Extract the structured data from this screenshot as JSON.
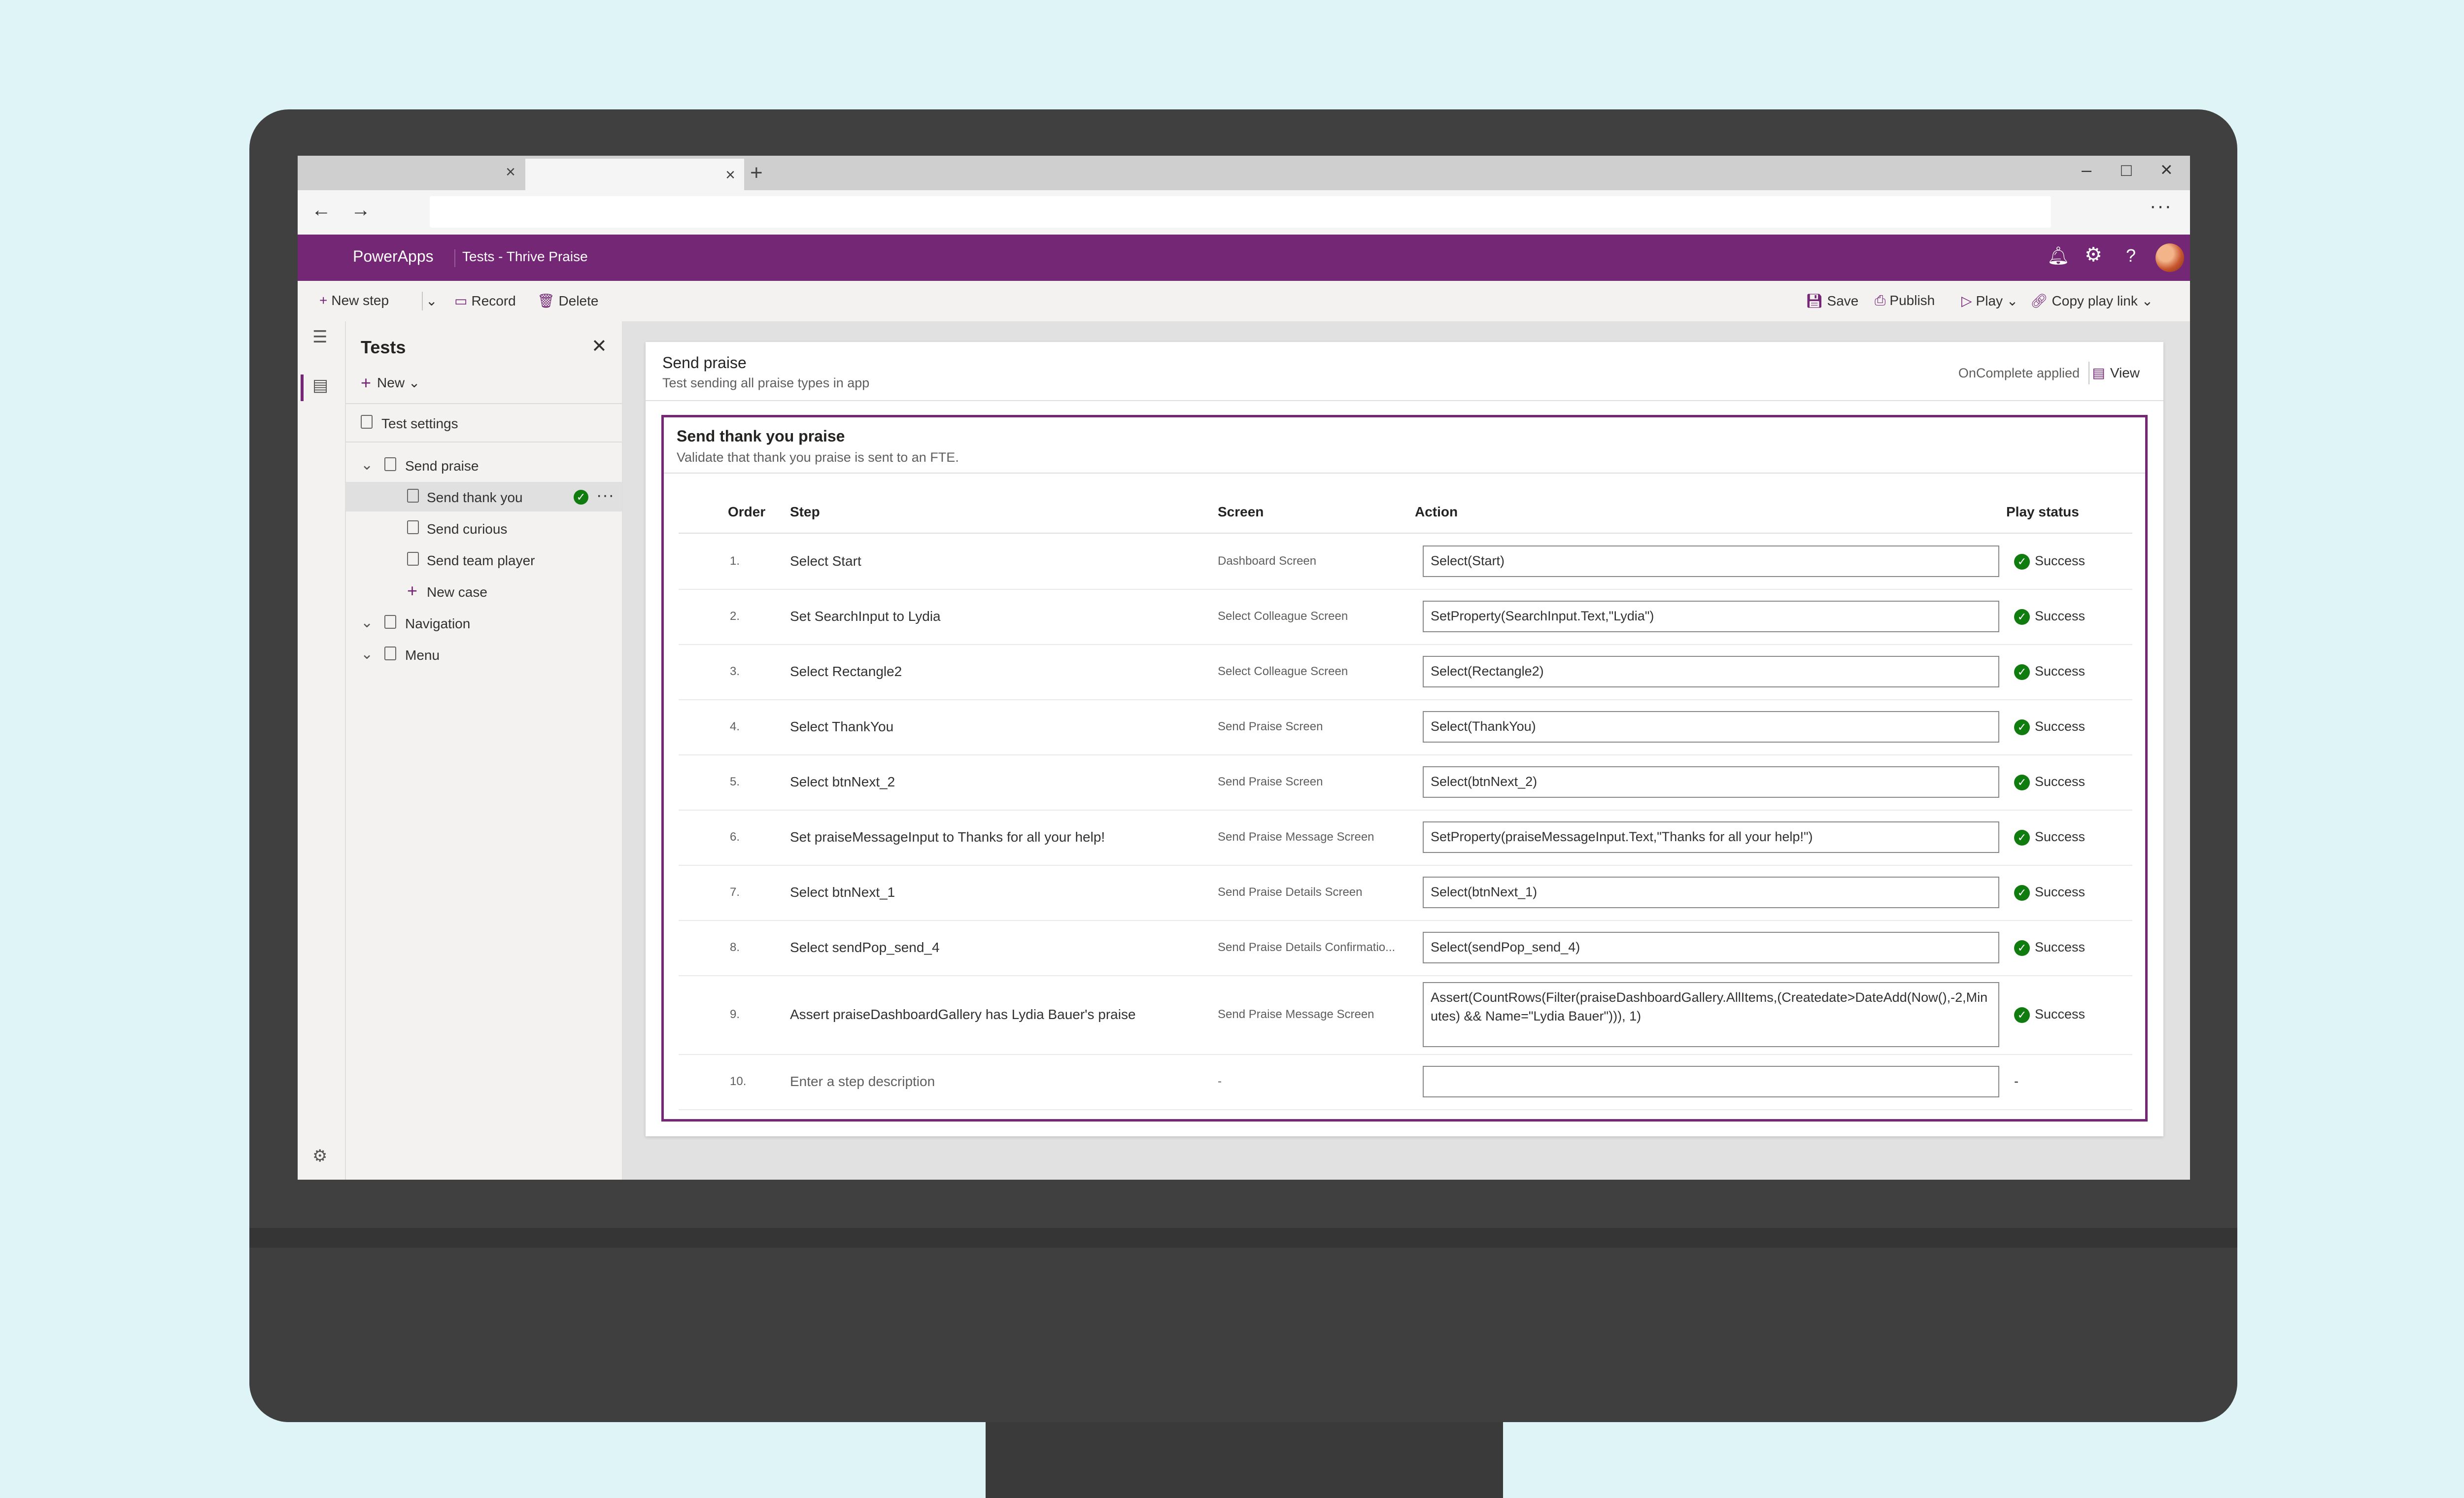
{
  "browser": {
    "tab_inactive_close": "×",
    "tab_active_close": "×",
    "new_tab": "+",
    "minimize": "–",
    "maximize": "□",
    "close": "×",
    "back": "←",
    "forward": "→",
    "more": "···"
  },
  "header": {
    "app_name": "PowerApps",
    "breadcrumb": "Tests - Thrive Praise",
    "brand_color": "#742774"
  },
  "toolbar": {
    "new_step": "New step",
    "record": "Record",
    "delete": "Delete",
    "save": "Save",
    "publish": "Publish",
    "play": "Play",
    "copy_play_link": "Copy play link"
  },
  "panel": {
    "title": "Tests",
    "new_label": "New",
    "test_settings": "Test settings",
    "suites": [
      {
        "label": "Send praise"
      },
      {
        "label": "Navigation"
      },
      {
        "label": "Menu"
      }
    ],
    "cases": [
      {
        "label": "Send thank you"
      },
      {
        "label": "Send curious"
      },
      {
        "label": "Send team player"
      }
    ],
    "new_case": "New case"
  },
  "suite": {
    "title": "Send praise",
    "description": "Test sending all praise types in app",
    "status": "OnComplete applied",
    "view_label": "View"
  },
  "case": {
    "title": "Send thank you praise",
    "description": "Validate that thank you praise is sent to an FTE."
  },
  "table": {
    "headers": {
      "order": "Order",
      "step": "Step",
      "screen": "Screen",
      "action": "Action",
      "status": "Play status"
    },
    "rows": [
      {
        "order": "1.",
        "step": "Select Start",
        "screen": "Dashboard Screen",
        "action": "Select(Start)",
        "status": "Success"
      },
      {
        "order": "2.",
        "step": "Set SearchInput to Lydia",
        "screen": "Select Colleague Screen",
        "action": "SetProperty(SearchInput.Text,\"Lydia\")",
        "status": "Success"
      },
      {
        "order": "3.",
        "step": "Select Rectangle2",
        "screen": "Select Colleague Screen",
        "action": "Select(Rectangle2)",
        "status": "Success"
      },
      {
        "order": "4.",
        "step": "Select ThankYou",
        "screen": "Send Praise Screen",
        "action": "Select(ThankYou)",
        "status": "Success"
      },
      {
        "order": "5.",
        "step": "Select btnNext_2",
        "screen": "Send Praise Screen",
        "action": "Select(btnNext_2)",
        "status": "Success"
      },
      {
        "order": "6.",
        "step": "Set praiseMessageInput to Thanks for all your help!",
        "screen": "Send Praise Message Screen",
        "action": "SetProperty(praiseMessageInput.Text,\"Thanks for all your help!\")",
        "status": "Success"
      },
      {
        "order": "7.",
        "step": "Select btnNext_1",
        "screen": "Send Praise Details Screen",
        "action": "Select(btnNext_1)",
        "status": "Success"
      },
      {
        "order": "8.",
        "step": "Select sendPop_send_4",
        "screen": "Send Praise Details Confirmatio...",
        "action": "Select(sendPop_send_4)",
        "status": "Success"
      },
      {
        "order": "9.",
        "step": "Assert praiseDashboardGallery has Lydia Bauer's praise",
        "screen": "Send Praise Message Screen",
        "action": "Assert(CountRows(Filter(praiseDashboardGallery.AllItems,(Createdate>DateAdd(Now(),-2,Minutes) && Name=\"Lydia Bauer\"))), 1)",
        "status": "Success"
      },
      {
        "order": "10.",
        "step": "Enter a step description",
        "screen": "-",
        "action": "",
        "status": "-"
      }
    ]
  },
  "colors": {
    "success": "#107c10",
    "accent": "#742774"
  },
  "icons": {
    "success": "✓",
    "plus": "+",
    "close": "✕",
    "chevron": "⌄",
    "more": "···"
  }
}
